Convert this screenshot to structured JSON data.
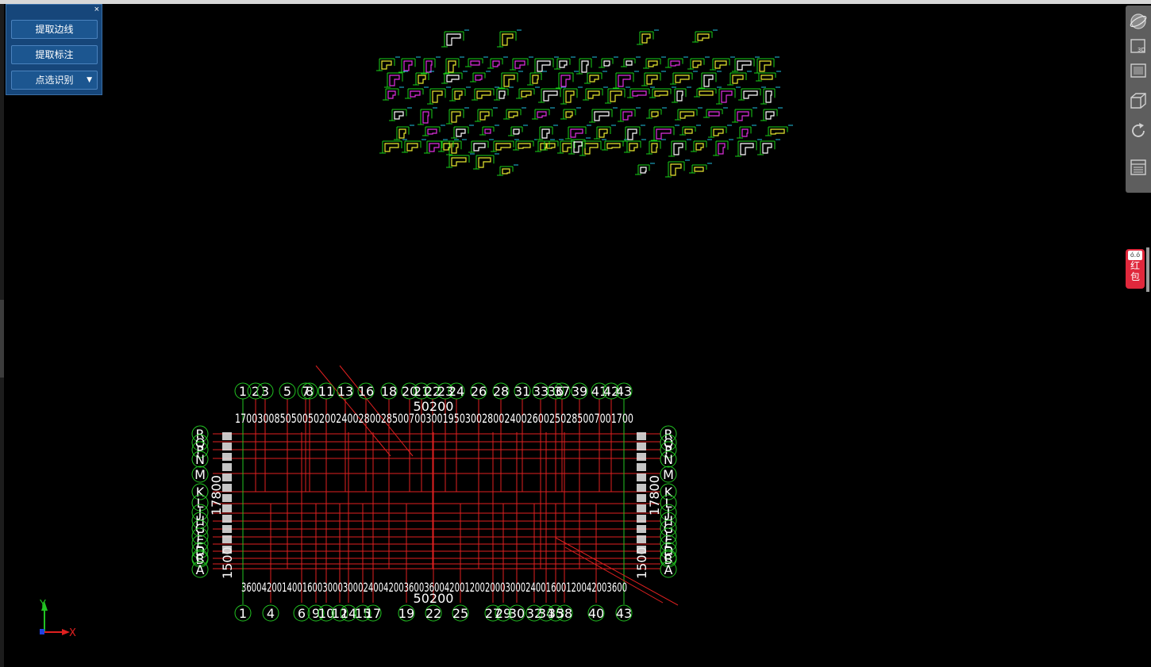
{
  "panel": {
    "close_label": "×",
    "buttons": [
      {
        "label": "提取边线"
      },
      {
        "label": "提取标注"
      },
      {
        "label": "点选识别",
        "dropdown": true
      }
    ]
  },
  "toolbar": {
    "icons": [
      "orbit-icon",
      "view-3d-icon",
      "top-view-icon",
      "box-view-icon",
      "rotate-icon",
      "layout-icon"
    ],
    "view3d_label": "3D"
  },
  "redbag": {
    "label1": "红",
    "label2": "包",
    "face": "ó.ó"
  },
  "axis": {
    "x_label": "X",
    "y_label": "Y"
  },
  "colors": {
    "panel": "#16467a",
    "grid_red": "#e02020",
    "bubble_green": "#22c322",
    "cad_green": "#19d019",
    "cad_yellow": "#e8e830",
    "cad_magenta": "#e030e0",
    "cad_cyan": "#20c0e0"
  },
  "grid": {
    "top_axes": [
      "1",
      "2",
      "3",
      "5",
      "7",
      "8",
      "11",
      "13",
      "16",
      "18",
      "20",
      "21",
      "22",
      "23",
      "24",
      "26",
      "28",
      "31",
      "33",
      "36",
      "37",
      "39",
      "41",
      "42",
      "43"
    ],
    "bottom_axes": [
      "1",
      "4",
      "6",
      "9",
      "10",
      "12",
      "14",
      "15",
      "17",
      "19",
      "22",
      "25",
      "27",
      "29",
      "30",
      "32",
      "34",
      "35",
      "38",
      "40",
      "43"
    ],
    "left_axes": [
      "R",
      "Q",
      "P",
      "N",
      "M",
      "K",
      "L",
      "J",
      "H",
      "G",
      "F",
      "E",
      "D",
      "C",
      "B",
      "A"
    ],
    "right_axes": [
      "R",
      "Q",
      "P",
      "N",
      "M",
      "K",
      "L",
      "J",
      "H",
      "G",
      "F",
      "E",
      "D",
      "C",
      "B",
      "A"
    ],
    "top_total": "50200",
    "bottom_total": "50200",
    "top_dims": "17003008505005020024002800285007003001950300280024002600250285007001700",
    "bottom_dims": "3600420014001600300030002400420036003600420012002000300024001600120042003600",
    "left_total": "17800",
    "right_total": "17800",
    "left_bottom_dim": "1500",
    "right_bottom_dim": "1500"
  }
}
